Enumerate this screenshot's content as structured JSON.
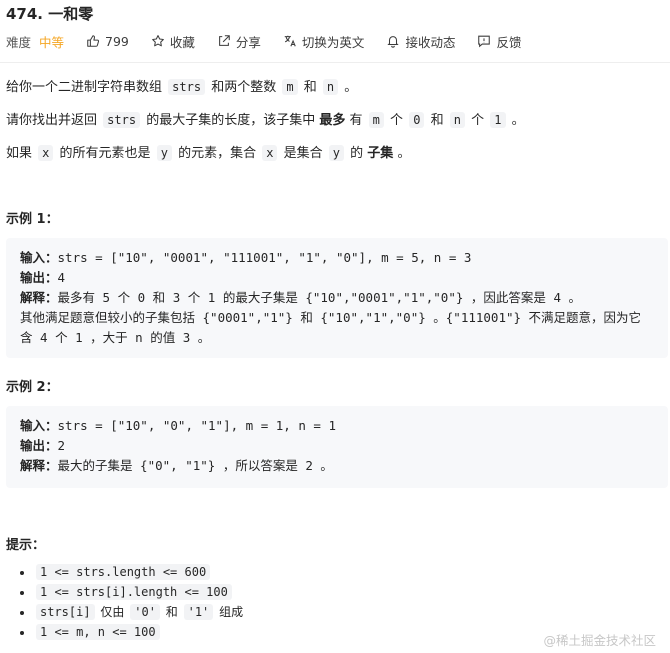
{
  "problem": {
    "title": "474. 一和零",
    "difficulty_label": "难度",
    "difficulty": "中等",
    "likes": "799",
    "favorite_label": "收藏",
    "share_label": "分享",
    "translate_label": "切换为英文",
    "subscribe_label": "接收动态",
    "feedback_label": "反馈"
  },
  "description": {
    "p1": {
      "t1": "给你一个二进制字符串数组",
      "c1": "strs",
      "t2": "和两个整数",
      "c2": "m",
      "t3": "和",
      "c3": "n",
      "t4": "。"
    },
    "p2": {
      "t1": "请你找出并返回",
      "c1": "strs",
      "t2": "的最大子集的长度，该子集中",
      "b1": "最多",
      "t3": "有",
      "c2": "m",
      "t4": "个",
      "c3": "0",
      "t5": "和",
      "c4": "n",
      "t6": "个",
      "c5": "1",
      "t7": "。"
    },
    "p3": {
      "t1": "如果",
      "c1": "x",
      "t2": "的所有元素也是",
      "c2": "y",
      "t3": "的元素，集合",
      "c3": "x",
      "t4": "是集合",
      "c4": "y",
      "t5": "的",
      "b1": "子集",
      "t6": "。"
    }
  },
  "example1": {
    "heading": "示例 1：",
    "input_label": "输入：",
    "input": "strs = [\"10\", \"0001\", \"111001\", \"1\", \"0\"], m = 5, n = 3",
    "output_label": "输出：",
    "output": "4",
    "explain_label": "解释：",
    "explain_1": "最多有 5 个 0 和 3 个 1 的最大子集是 {\"10\",\"0001\",\"1\",\"0\"} ，因此答案是 4 。",
    "explain_2": "其他满足题意但较小的子集包括 {\"0001\",\"1\"} 和 {\"10\",\"1\",\"0\"} 。{\"111001\"} 不满足题意，因为它",
    "explain_3": "含 4 个 1 ，大于 n 的值 3 。"
  },
  "example2": {
    "heading": "示例 2：",
    "input_label": "输入：",
    "input": "strs = [\"10\", \"0\", \"1\"], m = 1, n = 1",
    "output_label": "输出：",
    "output": "2",
    "explain_label": "解释：",
    "explain_1": "最大的子集是 {\"0\", \"1\"} ，所以答案是 2 。"
  },
  "constraints": {
    "heading": "提示：",
    "items": [
      {
        "code": "1 <= strs.length <= 600"
      },
      {
        "code": "1 <= strs[i].length <= 100"
      },
      {
        "c1": "strs[i]",
        "t1": "仅由",
        "c2": "'0'",
        "t2": "和",
        "c3": "'1'",
        "t3": "组成"
      },
      {
        "code": "1 <= m, n <= 100"
      }
    ]
  },
  "watermark": "@稀土掘金技术社区",
  "colors": {
    "difficulty_medium": "#f5a623",
    "code_bg": "#f2f3f5",
    "example_bg": "#f7f8fa",
    "text": "#262626",
    "watermark": "#c7c7c7"
  }
}
